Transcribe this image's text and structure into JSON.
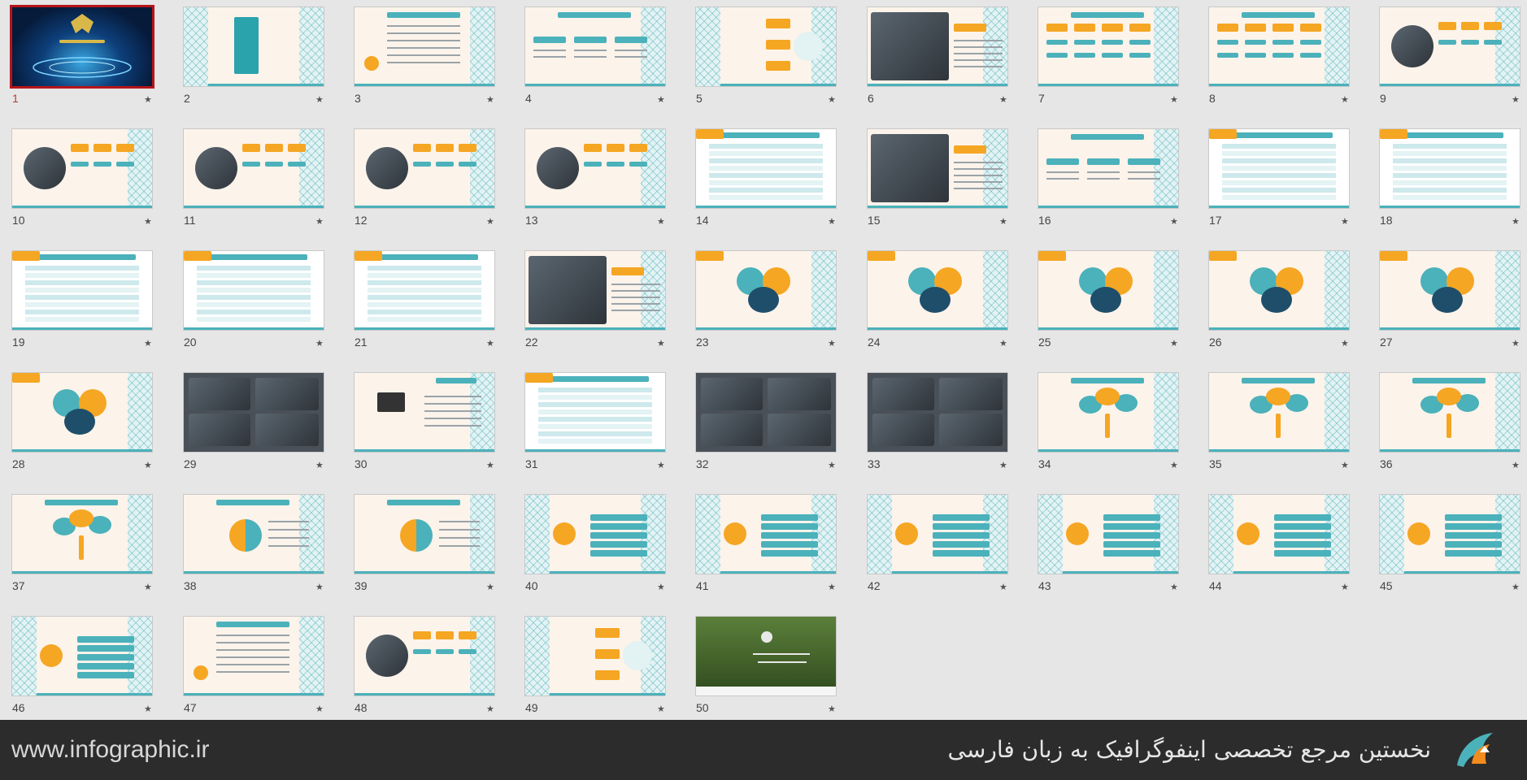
{
  "slides": [
    {
      "n": "1",
      "kind": "dark"
    },
    {
      "n": "2",
      "kind": "cal"
    },
    {
      "n": "3",
      "kind": "text"
    },
    {
      "n": "4",
      "kind": "cols"
    },
    {
      "n": "5",
      "kind": "pill"
    },
    {
      "n": "6",
      "kind": "photoright"
    },
    {
      "n": "7",
      "kind": "org"
    },
    {
      "n": "8",
      "kind": "org"
    },
    {
      "n": "9",
      "kind": "orgphoto"
    },
    {
      "n": "10",
      "kind": "orgphoto"
    },
    {
      "n": "11",
      "kind": "orgphoto"
    },
    {
      "n": "12",
      "kind": "orgphoto"
    },
    {
      "n": "13",
      "kind": "orgphoto"
    },
    {
      "n": "14",
      "kind": "table"
    },
    {
      "n": "15",
      "kind": "photoright"
    },
    {
      "n": "16",
      "kind": "cols"
    },
    {
      "n": "17",
      "kind": "table"
    },
    {
      "n": "18",
      "kind": "table"
    },
    {
      "n": "19",
      "kind": "table"
    },
    {
      "n": "20",
      "kind": "table"
    },
    {
      "n": "21",
      "kind": "table"
    },
    {
      "n": "22",
      "kind": "photoright"
    },
    {
      "n": "23",
      "kind": "petal"
    },
    {
      "n": "24",
      "kind": "petal"
    },
    {
      "n": "25",
      "kind": "petal"
    },
    {
      "n": "26",
      "kind": "petal"
    },
    {
      "n": "27",
      "kind": "petal"
    },
    {
      "n": "28",
      "kind": "petal"
    },
    {
      "n": "29",
      "kind": "photo"
    },
    {
      "n": "30",
      "kind": "icon"
    },
    {
      "n": "31",
      "kind": "table"
    },
    {
      "n": "32",
      "kind": "photo"
    },
    {
      "n": "33",
      "kind": "photo"
    },
    {
      "n": "34",
      "kind": "tree"
    },
    {
      "n": "35",
      "kind": "tree"
    },
    {
      "n": "36",
      "kind": "tree"
    },
    {
      "n": "37",
      "kind": "tree"
    },
    {
      "n": "38",
      "kind": "cycle"
    },
    {
      "n": "39",
      "kind": "cycle"
    },
    {
      "n": "40",
      "kind": "list"
    },
    {
      "n": "41",
      "kind": "list"
    },
    {
      "n": "42",
      "kind": "list"
    },
    {
      "n": "43",
      "kind": "list"
    },
    {
      "n": "44",
      "kind": "list"
    },
    {
      "n": "45",
      "kind": "list"
    },
    {
      "n": "46",
      "kind": "list"
    },
    {
      "n": "47",
      "kind": "text"
    },
    {
      "n": "48",
      "kind": "orgphoto"
    },
    {
      "n": "49",
      "kind": "pill"
    },
    {
      "n": "50",
      "kind": "green"
    }
  ],
  "selected_slide": "1",
  "footer": {
    "site": "www.infographic.ir",
    "tagline": "نخستین مرجع تخصصی اینفوگرافیک به زبان فارسی"
  },
  "colors": {
    "accent": "#4bb1ba",
    "orange": "#f5a623",
    "selected": "#b4151a",
    "background": "#e6e6e6"
  },
  "icons": {
    "star": "star-icon",
    "logo": "infographic-logo-icon"
  }
}
